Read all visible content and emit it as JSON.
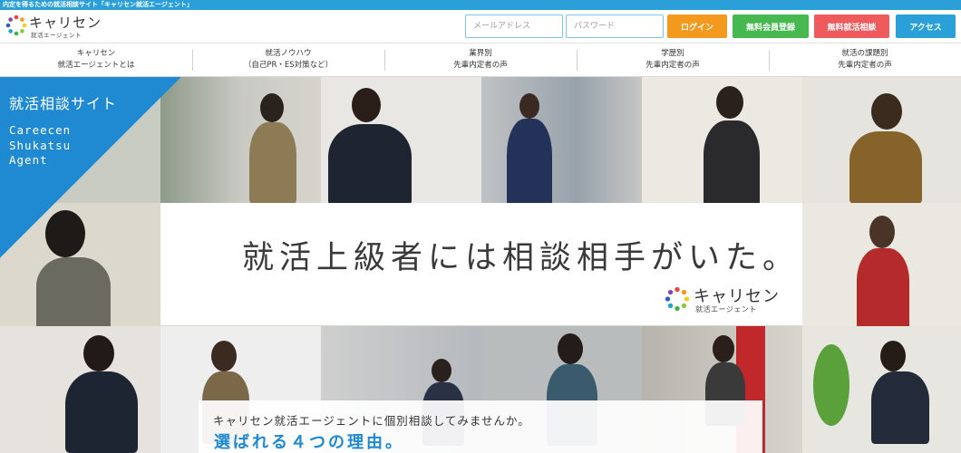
{
  "top_strip": {
    "text": "内定を得るための就活相談サイト「キャリセン就活エージェント」"
  },
  "header": {
    "logo_main": "キャリセン",
    "logo_sub": "就活エージェント",
    "email_placeholder": "メールアドレス",
    "password_placeholder": "パスワード",
    "buttons": [
      {
        "label": "ログイン",
        "color": "#f39a1e"
      },
      {
        "label": "無料会員登録",
        "color": "#46b84f"
      },
      {
        "label": "無料就活相談",
        "color": "#ef5a5d"
      },
      {
        "label": "アクセス",
        "color": "#2a9fd8"
      }
    ]
  },
  "nav": {
    "items": [
      {
        "line1": "キャリセン",
        "line2": "就活エージェントとは"
      },
      {
        "line1": "就活ノウハウ",
        "line2": "（自己PR・ES対策など）"
      },
      {
        "line1": "業界別",
        "line2": "先輩内定者の声"
      },
      {
        "line1": "学歴別",
        "line2": "先輩内定者の声"
      },
      {
        "line1": "就活の課題別",
        "line2": "先輩内定者の声"
      }
    ]
  },
  "hero": {
    "site_title": "就活相談サイト",
    "site_en": [
      "Careecen",
      "Shukatsu",
      "Agent"
    ],
    "headline": "就活上級者には相談相手がいた。",
    "logo_main": "キャリセン",
    "logo_sub": "就活エージェント",
    "bottom_sub": "キャリセン就活エージェントに個別相談してみませんか。",
    "bottom_main": "選ばれる４つの理由。"
  },
  "colors": {
    "accent": "#2a9fd8",
    "hero_blue": "#1f8ad2"
  }
}
